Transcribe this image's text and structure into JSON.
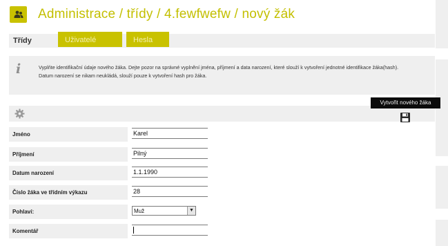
{
  "header": {
    "icon": "users-icon",
    "title": "Administrace / třídy / 4.fewfwefw / nový žák",
    "accent_color": "#c9c200"
  },
  "tabs": {
    "active_label": "Třídy",
    "items": [
      {
        "label": "Uživatelé"
      },
      {
        "label": "Hesla"
      }
    ]
  },
  "info": {
    "icon": "info-icon",
    "line1": "Vyplňte identifikační údaje nového žáka. Dejte pozor na správné vyplnění jména, příjmení a data narození, které slouží k vytvoření jednotné identifikace žáka(hash).",
    "line2": "Datum narození se nikam neukládá, slouží pouze k vytvoření hash pro žáka."
  },
  "toolbar": {
    "gear_icon": "gear-icon",
    "save_icon": "save-icon",
    "save_tooltip": "Vytvořit nového žáka"
  },
  "form": {
    "first_name": {
      "label": "Jméno",
      "value": "Karel"
    },
    "last_name": {
      "label": "Příjmení",
      "value": "Pilný"
    },
    "birth_date": {
      "label": "Datum narození",
      "value": "1.1.1990"
    },
    "class_number": {
      "label": "Číslo žáka ve třídním výkazu",
      "value": "28"
    },
    "gender": {
      "label": "Pohlaví:",
      "selected": "Muž"
    },
    "comment": {
      "label": "Komentář",
      "value": ""
    }
  }
}
